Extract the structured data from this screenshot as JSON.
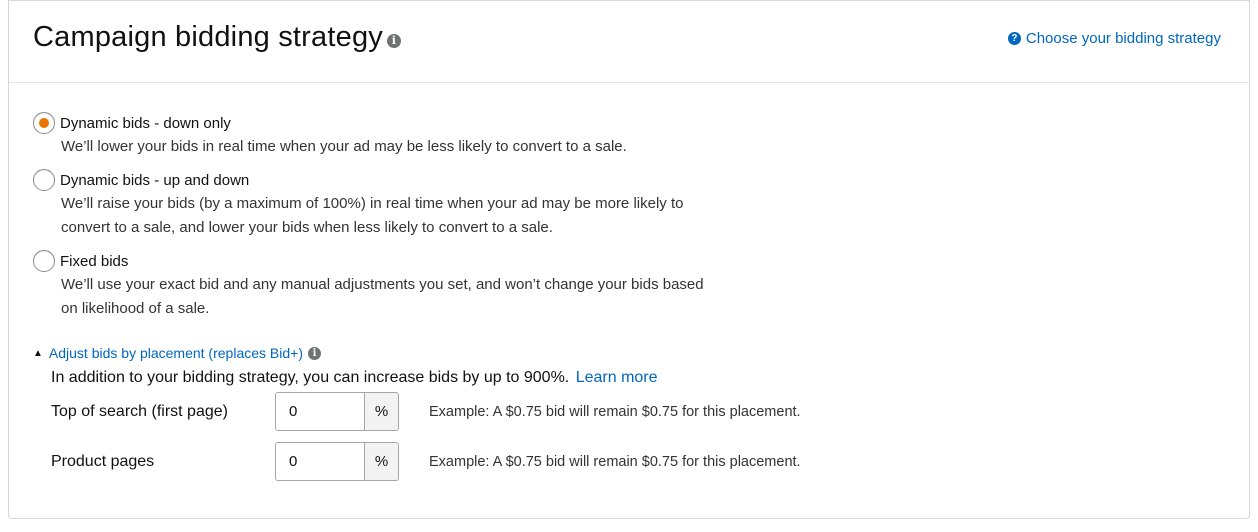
{
  "header": {
    "title": "Campaign bidding strategy",
    "help_link": "Choose your bidding strategy"
  },
  "options": [
    {
      "label": "Dynamic bids - down only",
      "description_lines": [
        "We’ll lower your bids in real time when your ad may be less likely to convert to a sale."
      ],
      "selected": true
    },
    {
      "label": "Dynamic bids - up and down",
      "description_lines": [
        "We’ll raise your bids (by a maximum of 100%) in real time when your ad may be more likely to",
        "convert to a sale, and lower your bids when less likely to convert to a sale."
      ],
      "selected": false
    },
    {
      "label": "Fixed bids",
      "description_lines": [
        "We’ll use your exact bid and any manual adjustments you set, and won’t change your bids based",
        "on likelihood of a sale."
      ],
      "selected": false
    }
  ],
  "placement": {
    "toggle_label": "Adjust bids by placement (replaces Bid+)",
    "intro_text": "In addition to your bidding strategy, you can increase bids by up to 900%.",
    "learn_more": "Learn more",
    "percent_symbol": "%",
    "rows": [
      {
        "label": "Top of search (first page)",
        "value": "0",
        "example": "Example: A $0.75 bid will remain $0.75 for this placement."
      },
      {
        "label": "Product pages",
        "value": "0",
        "example": "Example: A $0.75 bid will remain $0.75 for this placement."
      }
    ]
  },
  "colors": {
    "link": "#0066c0",
    "radio_selected": "#e77600",
    "border": "#d5d9d9"
  }
}
